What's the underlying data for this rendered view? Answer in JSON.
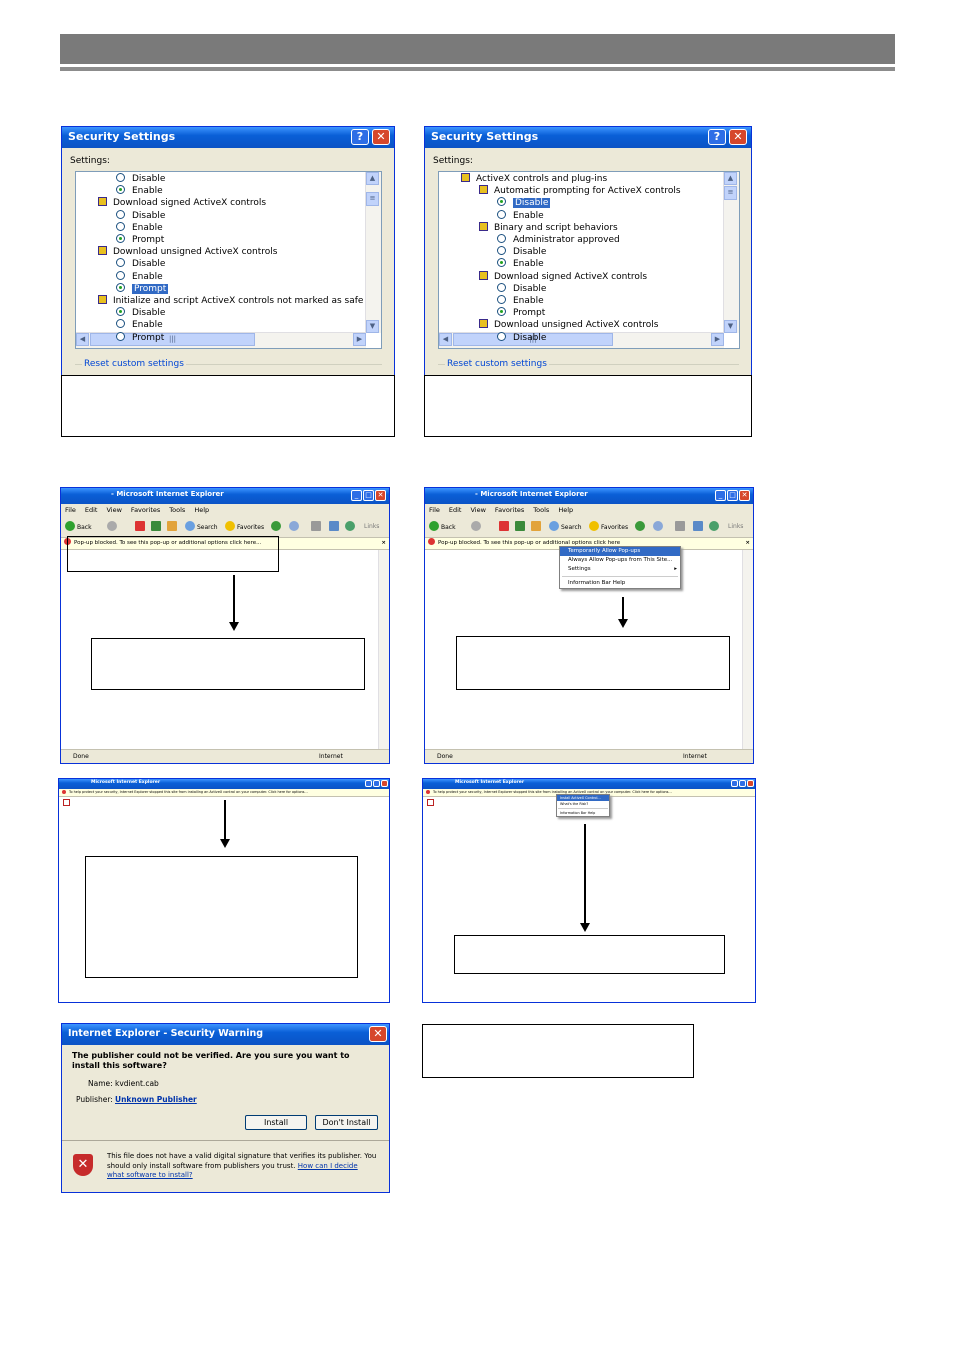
{
  "dialog_left": {
    "title": "Security Settings",
    "settings_label": "Settings:",
    "rows": [
      {
        "kind": "radio",
        "indent": 1,
        "label": "Disable",
        "checked": false
      },
      {
        "kind": "radio",
        "indent": 1,
        "label": "Enable",
        "checked": true
      },
      {
        "kind": "group",
        "indent": 0,
        "label": "Download signed ActiveX controls"
      },
      {
        "kind": "radio",
        "indent": 1,
        "label": "Disable",
        "checked": false
      },
      {
        "kind": "radio",
        "indent": 1,
        "label": "Enable",
        "checked": false
      },
      {
        "kind": "radio",
        "indent": 1,
        "label": "Prompt",
        "checked": true
      },
      {
        "kind": "group",
        "indent": 0,
        "label": "Download unsigned ActiveX controls"
      },
      {
        "kind": "radio",
        "indent": 1,
        "label": "Disable",
        "checked": false
      },
      {
        "kind": "radio",
        "indent": 1,
        "label": "Enable",
        "checked": false
      },
      {
        "kind": "radio",
        "indent": 1,
        "label": "Prompt",
        "checked": true,
        "selected": true
      },
      {
        "kind": "group",
        "indent": 0,
        "label": "Initialize and script ActiveX controls not marked as safe"
      },
      {
        "kind": "radio",
        "indent": 1,
        "label": "Disable",
        "checked": true
      },
      {
        "kind": "radio",
        "indent": 1,
        "label": "Enable",
        "checked": false
      },
      {
        "kind": "radio",
        "indent": 1,
        "label": "Prompt",
        "checked": false
      }
    ],
    "reset_label": "Reset custom settings"
  },
  "dialog_right": {
    "title": "Security Settings",
    "settings_label": "Settings:",
    "rows": [
      {
        "kind": "group",
        "indent": 0,
        "label": "ActiveX controls and plug-ins"
      },
      {
        "kind": "group",
        "indent": 1,
        "label": "Automatic prompting for ActiveX controls"
      },
      {
        "kind": "radio",
        "indent": 2,
        "label": "Disable",
        "checked": true,
        "selected": true
      },
      {
        "kind": "radio",
        "indent": 2,
        "label": "Enable",
        "checked": false
      },
      {
        "kind": "group",
        "indent": 1,
        "label": "Binary and script behaviors"
      },
      {
        "kind": "radio",
        "indent": 2,
        "label": "Administrator approved",
        "checked": false
      },
      {
        "kind": "radio",
        "indent": 2,
        "label": "Disable",
        "checked": false
      },
      {
        "kind": "radio",
        "indent": 2,
        "label": "Enable",
        "checked": true
      },
      {
        "kind": "group",
        "indent": 1,
        "label": "Download signed ActiveX controls"
      },
      {
        "kind": "radio",
        "indent": 2,
        "label": "Disable",
        "checked": false
      },
      {
        "kind": "radio",
        "indent": 2,
        "label": "Enable",
        "checked": false
      },
      {
        "kind": "radio",
        "indent": 2,
        "label": "Prompt",
        "checked": true
      },
      {
        "kind": "group",
        "indent": 1,
        "label": "Download unsigned ActiveX controls"
      },
      {
        "kind": "radio",
        "indent": 2,
        "label": "Disable",
        "checked": false
      }
    ],
    "reset_label": "Reset custom settings"
  },
  "ie": {
    "title": "- Microsoft Internet Explorer",
    "title_small": "Microsoft Internet Explorer",
    "menu": [
      "File",
      "Edit",
      "View",
      "Favorites",
      "Tools",
      "Help"
    ],
    "back_label": "Back",
    "search_label": "Search",
    "favorites_label": "Favorites",
    "links_label": "Links",
    "popup_blocked_text": "Pop-up blocked. To see this pop-up or additional options click here...",
    "popup_blocked_text_short": "Pop-up blocked. To see this pop-up or additional options click here",
    "activex_blocked_text": "To help protect your security, Internet Explorer stopped this site from installing an ActiveX control on your computer. Click here for options...",
    "status_done": "Done",
    "status_zone": "Internet",
    "popup_menu": [
      "Temporarily Allow Pop-ups",
      "Always Allow Pop-ups from This Site...",
      "Settings",
      "Information Bar Help"
    ],
    "activex_menu": [
      "Install ActiveX Control...",
      "What's the Risk?",
      "Information Bar Help"
    ]
  },
  "warning": {
    "title": "Internet Explorer - Security Warning",
    "question": "The publisher could not be verified.  Are you sure you want to install this software?",
    "name_label": "Name:",
    "name_value": "kvdient.cab",
    "publisher_label": "Publisher:",
    "publisher_value": "Unknown Publisher",
    "install_label": "Install",
    "dont_install_label": "Don't Install",
    "footer_text": "This file does not have a valid digital signature that verifies its publisher.  You should only install software from publishers you trust.",
    "footer_link": "How can I decide what software to install?"
  }
}
